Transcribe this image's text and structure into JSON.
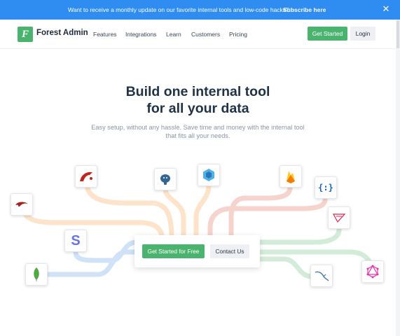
{
  "banner": {
    "text": "Want to receive a monthly update on our favorite internal tools and low-code hacks?",
    "link": "Subscribe here",
    "close_glyph": "✕"
  },
  "nav": {
    "logo_letter": "F",
    "logo_text": "Forest Admin",
    "links": [
      "Features",
      "Integrations",
      "Learn",
      "Customers",
      "Pricing"
    ],
    "get_started": "Get Started",
    "login": "Login"
  },
  "hero": {
    "title_line1": "Build one internal tool",
    "title_line2": "for all your data",
    "subtitle": "Easy setup, without any hassle. Save time and money with the internal tool that fits all your needs."
  },
  "cta": {
    "primary": "Get Started for Free",
    "secondary": "Contact Us"
  },
  "integrations": {
    "icons": [
      "rails-icon",
      "ruby-icon",
      "postgresql-icon",
      "sequelize-icon",
      "firebase-icon",
      "json-api-icon",
      "nestjs-icon",
      "stripe-icon",
      "graphql-icon",
      "mongodb-icon",
      "mysql-icon"
    ],
    "stripe_letter": "S",
    "json_glyph": "{:}"
  },
  "colors": {
    "banner_bg": "#2f8cf0",
    "brand_green": "#4ab46e",
    "title": "#1f3246",
    "path_orange": "#fde3c9",
    "path_red": "#f6d3cd",
    "path_blue": "#cfe2f8",
    "path_green": "#d3ecd9"
  }
}
